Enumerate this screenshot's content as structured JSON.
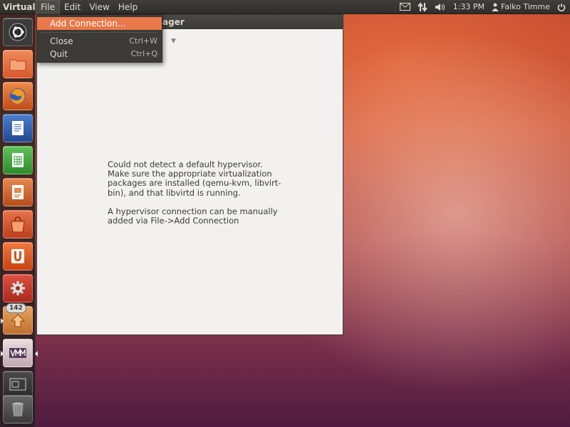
{
  "panel": {
    "app_name": "Virtual",
    "menus": [
      "File",
      "Edit",
      "View",
      "Help"
    ],
    "clock": "1:33 PM",
    "user": "Falko Timme",
    "icons": [
      "mail-icon",
      "network-icon",
      "volume-icon",
      "user-icon",
      "power-icon"
    ]
  },
  "window": {
    "title_visible": "ager",
    "message_line_1": "Could not detect a default hypervisor. Make sure the appropriate virtualization packages are installed (qemu-kvm, libvirt-bin), and that libvirtd is running.",
    "message_line_2": "A hypervisor connection can be manually added via File->Add Connection"
  },
  "file_menu": {
    "items": [
      {
        "label": "Add Connection...",
        "shortcut": "",
        "highlighted": true
      },
      {
        "label": "Close",
        "shortcut": "Ctrl+W",
        "highlighted": false
      },
      {
        "label": "Quit",
        "shortcut": "Ctrl+Q",
        "highlighted": false
      }
    ]
  },
  "launcher": {
    "items": [
      {
        "name": "dash-home",
        "color": "#3b3b3b"
      },
      {
        "name": "home-folder",
        "color": "#e96a3a"
      },
      {
        "name": "firefox",
        "color": "#d6531f"
      },
      {
        "name": "libreoffice-writer",
        "color": "#2c5aa8"
      },
      {
        "name": "libreoffice-calc",
        "color": "#3a9a35"
      },
      {
        "name": "libreoffice-impress",
        "color": "#c45a22"
      },
      {
        "name": "software-center",
        "color": "#d4542a"
      },
      {
        "name": "ubuntu-one",
        "color": "#e2551f"
      },
      {
        "name": "system-settings",
        "color": "#d13a2a"
      },
      {
        "name": "update-manager",
        "color": "#d9893e"
      },
      {
        "name": "virt-manager",
        "color": "#d9c8cc"
      },
      {
        "name": "workspace-switcher",
        "color": "#3a3a3a"
      },
      {
        "name": "trash",
        "color": "#555555"
      }
    ],
    "update_badge": "142"
  },
  "colors": {
    "accent": "#e9784a",
    "panel_bg": "#3c3b37",
    "window_bg": "#f2f1f0"
  }
}
